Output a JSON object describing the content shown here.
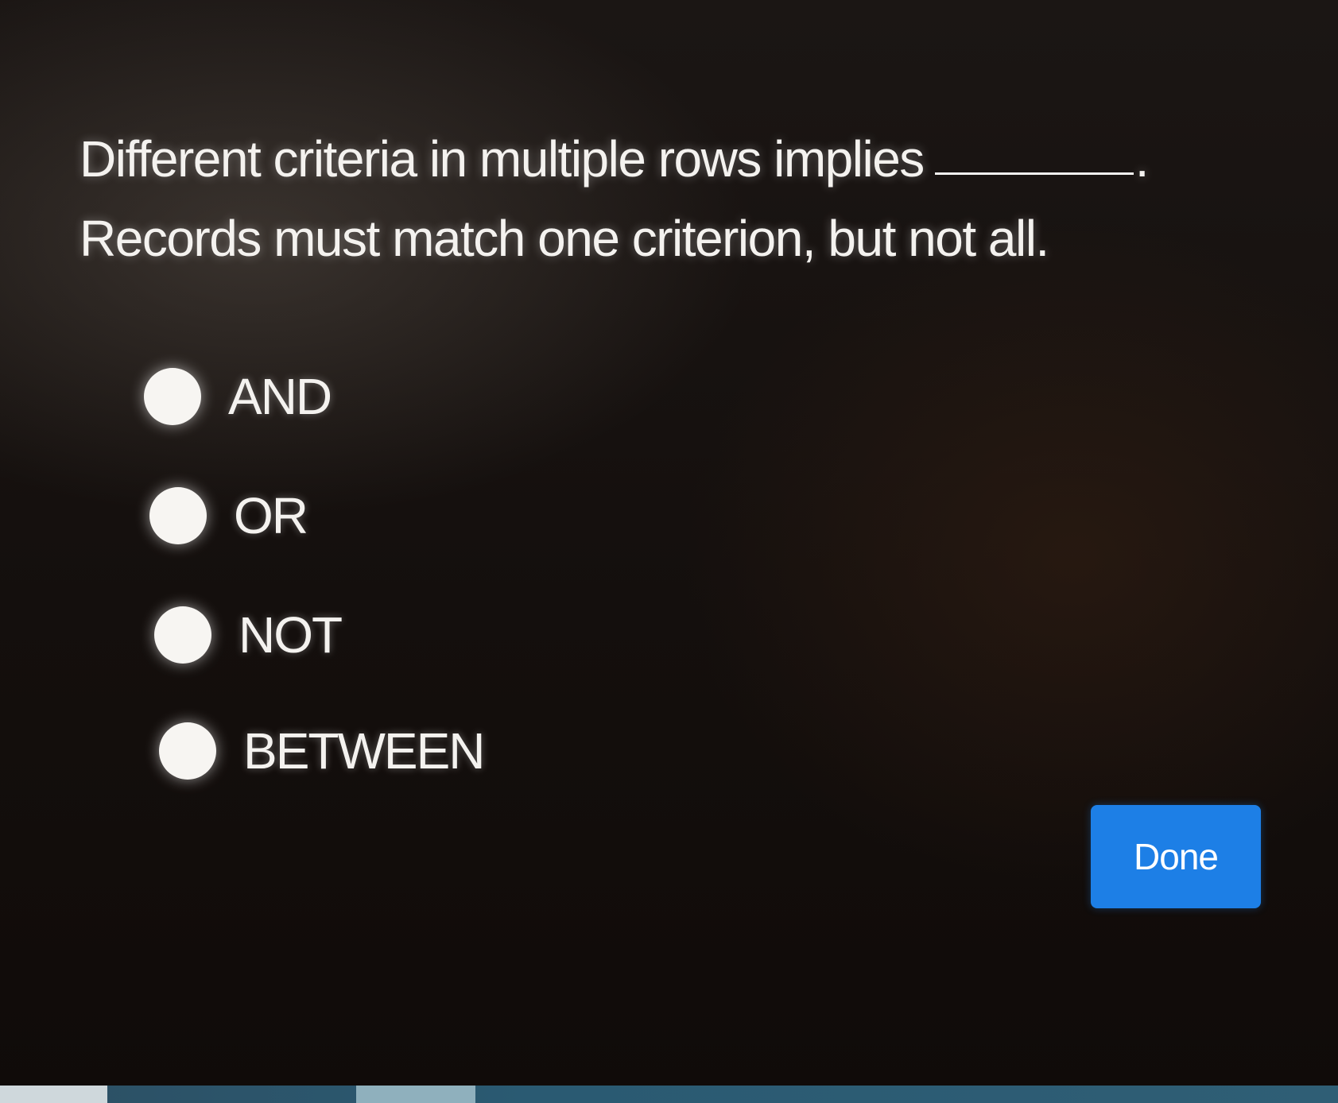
{
  "question": {
    "line1": "Different criteria in multiple rows implies",
    "line1_end": ".",
    "line2": "Records must match one criterion, but not all."
  },
  "options": [
    {
      "label": "AND",
      "selected": false
    },
    {
      "label": "OR",
      "selected": false
    },
    {
      "label": "NOT",
      "selected": false
    },
    {
      "label": "BETWEEN",
      "selected": false
    }
  ],
  "done_button": {
    "label": "Done",
    "color": "#1d7fe6"
  }
}
